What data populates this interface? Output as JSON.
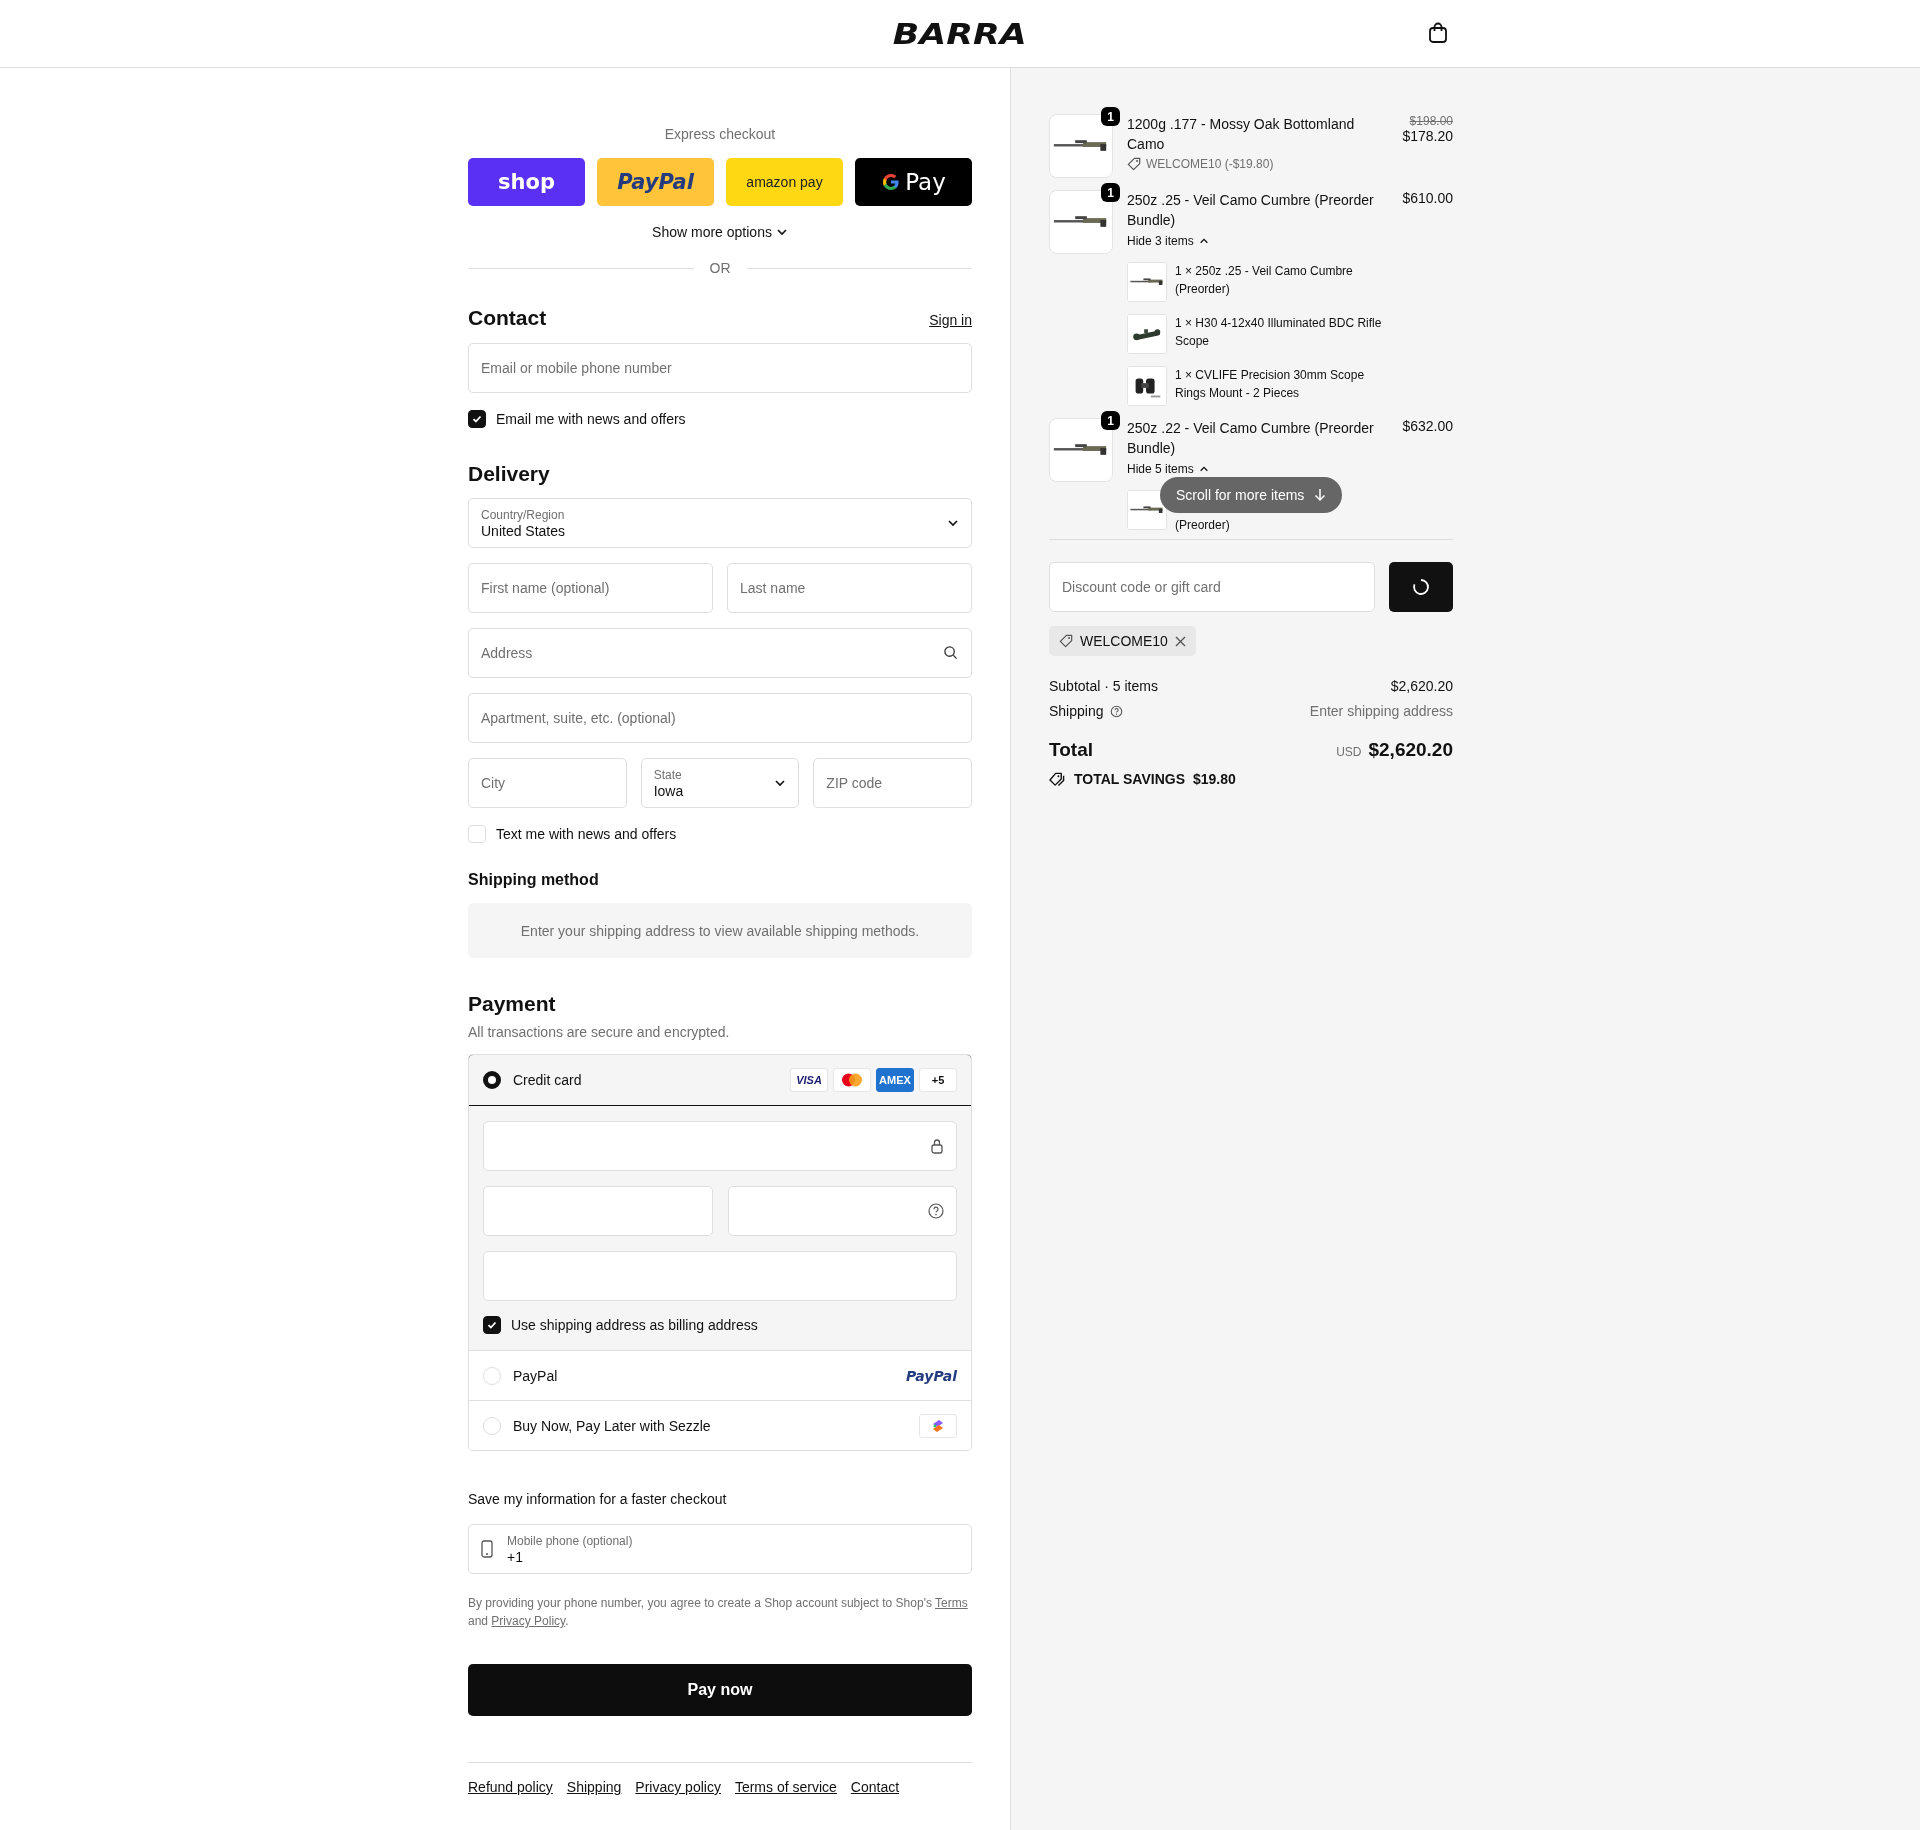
{
  "header": {
    "logo": "BARRA"
  },
  "express": {
    "label": "Express checkout",
    "buttons": [
      {
        "kind": "shop",
        "label": "shop"
      },
      {
        "kind": "paypal",
        "label": "PayPal"
      },
      {
        "kind": "amazon",
        "label": "amazon pay"
      },
      {
        "kind": "gpay",
        "label": "Pay"
      }
    ],
    "more": "Show more options",
    "divider": "OR"
  },
  "contact": {
    "title": "Contact",
    "sign_in": "Sign in",
    "email_placeholder": "Email or mobile phone number",
    "news": {
      "label": "Email me with news and offers",
      "checked": true
    }
  },
  "delivery": {
    "title": "Delivery",
    "rows": [
      {
        "fields": [
          {
            "kind": "select",
            "label": "Country/Region",
            "value": "United States"
          }
        ]
      },
      {
        "fields": [
          {
            "kind": "input",
            "placeholder": "First name (optional)"
          },
          {
            "kind": "input",
            "placeholder": "Last name"
          }
        ]
      },
      {
        "fields": [
          {
            "kind": "search",
            "placeholder": "Address"
          }
        ]
      },
      {
        "fields": [
          {
            "kind": "input",
            "placeholder": "Apartment, suite, etc. (optional)"
          }
        ]
      },
      {
        "fields": [
          {
            "kind": "input",
            "placeholder": "City"
          },
          {
            "kind": "select",
            "label": "State",
            "value": "Iowa"
          },
          {
            "kind": "input",
            "placeholder": "ZIP code"
          }
        ]
      }
    ],
    "text_news": {
      "label": "Text me with news and offers",
      "checked": false
    }
  },
  "shipping_method": {
    "title": "Shipping method",
    "message": "Enter your shipping address to view available shipping methods."
  },
  "payment": {
    "title": "Payment",
    "subtitle": "All transactions are secure and encrypted.",
    "methods": [
      {
        "kind": "card",
        "label": "Credit card",
        "selected": true,
        "brands": [
          {
            "kind": "visa",
            "label": "VISA"
          },
          {
            "kind": "mastercard"
          },
          {
            "kind": "amex",
            "label": "AMEX"
          },
          {
            "kind": "more",
            "label": "+5"
          }
        ],
        "billing": {
          "label": "Use shipping address as billing address",
          "checked": true
        }
      },
      {
        "kind": "paypal",
        "label": "PayPal",
        "logo": "PayPal",
        "selected": false
      },
      {
        "kind": "sezzle",
        "label": "Buy Now, Pay Later with Sezzle",
        "selected": false
      }
    ]
  },
  "save": {
    "title": "Save my information for a faster checkout",
    "phone": {
      "label": "Mobile phone (optional)",
      "value": "+1"
    },
    "disclaimer": [
      {
        "kind": "text",
        "text": "By providing your phone number, you agree to create a Shop account subject to Shop's "
      },
      {
        "kind": "link",
        "text": "Terms"
      },
      {
        "kind": "text",
        "text": " and "
      },
      {
        "kind": "link",
        "text": "Privacy Policy"
      },
      {
        "kind": "text",
        "text": "."
      }
    ]
  },
  "pay_button": "Pay now",
  "footer_links": [
    "Refund policy",
    "Shipping",
    "Privacy policy",
    "Terms of service",
    "Contact"
  ],
  "cart": {
    "items": [
      {
        "qty": "1",
        "title": "1200g .177 - Mossy Oak Bottomland Camo",
        "original_price": "$198.00",
        "price": "$178.20",
        "discount": "WELCOME10 (-$19.80)"
      },
      {
        "qty": "1",
        "title": "250z .25 - Veil Camo Cumbre (Preorder Bundle)",
        "price": "$610.00",
        "toggle": "Hide 3 items",
        "expanded": true,
        "components": [
          "1 × 250z .25 - Veil Camo Cumbre (Preorder)",
          "1 × H30 4-12x40 Illuminated BDC Rifle Scope",
          "1 × CVLIFE Precision 30mm Scope Rings Mount - 2 Pieces"
        ]
      },
      {
        "qty": "1",
        "title": "250z .22 - Veil Camo Cumbre (Preorder Bundle)",
        "price": "$632.00",
        "toggle": "Hide 5 items",
        "expanded": true,
        "components": [
          "(Preorder)"
        ]
      }
    ],
    "scroll_hint": "Scroll for more items"
  },
  "discount": {
    "placeholder": "Discount code or gift card",
    "applied": "WELCOME10"
  },
  "summary": {
    "subtotal_label": "Subtotal · 5 items",
    "subtotal": "$2,620.20",
    "shipping_label": "Shipping",
    "shipping_value": "Enter shipping address",
    "total_label": "Total",
    "currency": "USD",
    "total": "$2,620.20",
    "savings_label": "TOTAL SAVINGS",
    "savings": "$19.80"
  }
}
